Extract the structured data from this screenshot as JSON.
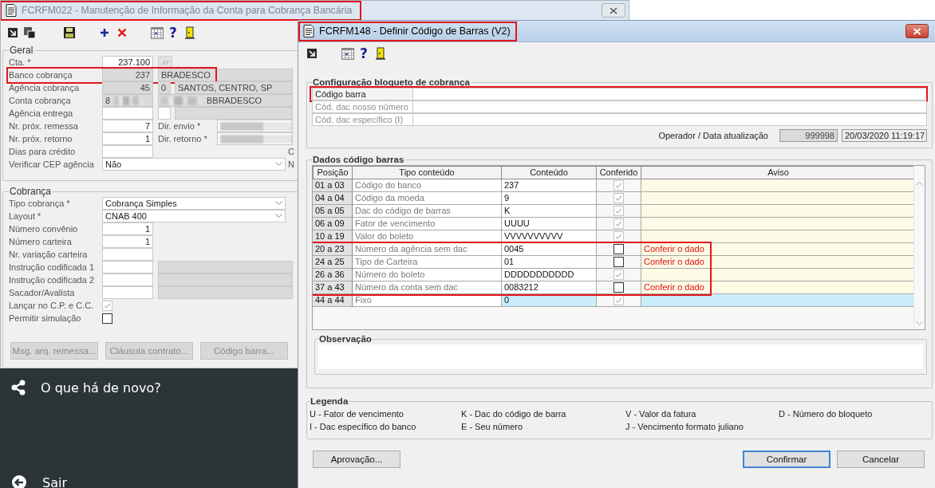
{
  "main_window": {
    "title": "FCRFM022 - Manutenção de Informação da Conta para Cobrança Bancária",
    "title_highlighted": true,
    "toolbar": [
      {
        "kind": "pointer"
      },
      {
        "kind": "windows"
      },
      {
        "kind": "save"
      },
      {
        "kind": "add"
      },
      {
        "kind": "delete"
      },
      {
        "kind": "calendar"
      },
      {
        "kind": "help",
        "glyph": "?"
      },
      {
        "kind": "exit"
      }
    ],
    "groups": [
      {
        "title": "Geral",
        "rows": [
          {
            "label": "Cta. *",
            "highlighted": false,
            "fields": [
              {
                "kind": "input",
                "value": "237.100",
                "readonly": false
              },
              {
                "kind": "lookup"
              }
            ]
          },
          {
            "label": "Banco cobrança",
            "highlighted": true,
            "fields": [
              {
                "kind": "input",
                "value": "237",
                "readonly": true
              },
              {
                "kind": "input",
                "value": "BRADESCO",
                "readonly": true
              }
            ]
          },
          {
            "label": "Agência cobrança",
            "highlighted": false,
            "fields": [
              {
                "kind": "input",
                "value": "45",
                "readonly": true
              },
              {
                "kind": "input",
                "value": "0",
                "readonly": true
              },
              {
                "kind": "input",
                "value": "SANTOS, CENTRO, SP",
                "readonly": true
              }
            ]
          },
          {
            "label": "Conta cobrança",
            "highlighted": false,
            "fields": [
              {
                "kind": "masked",
                "value": "8",
                "readonly": true
              },
              {
                "kind": "masked",
                "value": "BBRADESCO",
                "readonly": true
              }
            ]
          },
          {
            "label": "Agência entrega",
            "highlighted": false,
            "fields": [
              {
                "kind": "input",
                "readonly": false
              },
              {
                "kind": "input",
                "readonly": false
              },
              {
                "kind": "input",
                "readonly": true
              }
            ]
          },
          {
            "label": "Nr. próx. remessa",
            "highlighted": false,
            "fields": [
              {
                "kind": "input",
                "value": "7",
                "readonly": false
              },
              {
                "kind": "label",
                "value": "Dir. envio *"
              },
              {
                "kind": "masked",
                "readonly": false
              }
            ]
          },
          {
            "label": "Nr. próx. retorno",
            "highlighted": false,
            "fields": [
              {
                "kind": "input",
                "value": "1",
                "readonly": false
              },
              {
                "kind": "label",
                "value": "Dir. retorno *"
              },
              {
                "kind": "masked",
                "readonly": false
              }
            ]
          },
          {
            "label": "Dias para crédito",
            "highlighted": false,
            "fields": [
              {
                "kind": "input",
                "readonly": false
              }
            ],
            "far_label": "C"
          },
          {
            "label": "Verificar CEP agência",
            "highlighted": false,
            "fields": [
              {
                "kind": "select",
                "value": "Não"
              }
            ],
            "far_label": "N"
          }
        ]
      },
      {
        "title": "Cobrança",
        "rows": [
          {
            "label": "Tipo cobrança *",
            "highlighted": false,
            "fields": [
              {
                "kind": "select",
                "value": "Cobrança Simples"
              }
            ]
          },
          {
            "label": "Layout *",
            "highlighted": false,
            "fields": [
              {
                "kind": "select",
                "value": "CNAB 400"
              }
            ]
          },
          {
            "label": "Número convênio",
            "highlighted": false,
            "fields": [
              {
                "kind": "input",
                "value": "1",
                "readonly": false
              }
            ]
          },
          {
            "label": "Número carteira",
            "highlighted": false,
            "fields": [
              {
                "kind": "input",
                "value": "1",
                "readonly": false
              }
            ]
          },
          {
            "label": "Nr. variação carteira",
            "highlighted": false,
            "fields": [
              {
                "kind": "input",
                "readonly": false
              }
            ]
          },
          {
            "label": "Instrução codificada 1",
            "highlighted": false,
            "fields": [
              {
                "kind": "input",
                "readonly": false
              },
              {
                "kind": "input",
                "readonly": true
              }
            ]
          },
          {
            "label": "Instrução codificada 2",
            "highlighted": false,
            "fields": [
              {
                "kind": "input",
                "readonly": false
              },
              {
                "kind": "input",
                "readonly": true
              }
            ]
          },
          {
            "label": "Sacador/Avalista",
            "highlighted": false,
            "fields": [
              {
                "kind": "input",
                "readonly": false
              },
              {
                "kind": "input",
                "readonly": true
              }
            ]
          },
          {
            "label": "Lançar no C.P. e C.C.",
            "highlighted": false,
            "fields": [
              {
                "kind": "checkbox",
                "checked": true
              }
            ]
          },
          {
            "label": "Permitir simulação",
            "highlighted": false,
            "fields": [
              {
                "kind": "checkbox",
                "checked": false
              }
            ]
          }
        ]
      }
    ],
    "buttons": [
      {
        "label": "Msg. arq. remessa...",
        "disabled": true
      },
      {
        "label": "Cláusula contrato...",
        "disabled": true
      },
      {
        "label": "Código barra...",
        "disabled": true
      }
    ]
  },
  "side_panel": {
    "items": [
      {
        "kind": "share",
        "label": "O que há de novo?"
      },
      {
        "kind": "exit",
        "label": "Sair"
      }
    ]
  },
  "dialog": {
    "title": "FCRFM148 - Definir Código de Barras (V2)",
    "title_highlighted": true,
    "toolbar": [
      {
        "kind": "pointer"
      },
      {
        "kind": "calendar"
      },
      {
        "kind": "help",
        "glyph": "?"
      },
      {
        "kind": "exit"
      }
    ],
    "config": {
      "title": "Configuração bloqueto de cobrança",
      "rows": [
        {
          "label": "Código barra",
          "disabled": false,
          "highlighted": true
        },
        {
          "label": "Cód. dac nosso número",
          "disabled": true,
          "highlighted": false
        },
        {
          "label": "Cód. dac específico (I)",
          "disabled": true,
          "highlighted": false
        }
      ],
      "operator_label": "Operador / Data atualização",
      "operator": "999998",
      "updated_at": "20/03/2020 11:19:17"
    },
    "barcode": {
      "title": "Dados código barras",
      "columns": [
        "Posição",
        "Tipo conteúdo",
        "Conteúdo",
        "Conferido",
        "Aviso"
      ],
      "rows": [
        {
          "position": "01 a 03",
          "type": "Código do banco",
          "content": "237",
          "checked": true,
          "selected": false,
          "highlighted": false
        },
        {
          "position": "04 a 04",
          "type": "Código da moeda",
          "content": "9",
          "checked": true,
          "selected": false,
          "highlighted": false
        },
        {
          "position": "05 a 05",
          "type": "Dac do código de barras",
          "content": "K",
          "checked": true,
          "selected": false,
          "highlighted": false
        },
        {
          "position": "06 a 09",
          "type": "Fator de vencimento",
          "content": "UUUU",
          "checked": true,
          "selected": false,
          "highlighted": false
        },
        {
          "position": "10 a 19",
          "type": "Valor do boleto",
          "content": "VVVVVVVVVV",
          "checked": true,
          "selected": false,
          "highlighted": false
        },
        {
          "position": "20 a 23",
          "type": "Número da agência sem dac",
          "content": "0045",
          "checked": false,
          "warning": "Conferir o dado",
          "selected": false,
          "highlighted": true
        },
        {
          "position": "24 a 25",
          "type": "Tipo de Carteira",
          "content": "01",
          "checked": false,
          "warning": "Conferir o dado",
          "selected": false,
          "highlighted": true
        },
        {
          "position": "26 a 36",
          "type": "Número do boleto",
          "content": "DDDDDDDDDDD",
          "checked": true,
          "selected": false,
          "highlighted": true
        },
        {
          "position": "37 a 43",
          "type": "Número da conta sem dac",
          "content": "0083212",
          "checked": false,
          "warning": "Conferir o dado",
          "selected": false,
          "highlighted": true
        },
        {
          "position": "44 a 44",
          "type": "Fixo",
          "content": "0",
          "checked": true,
          "selected": true,
          "highlighted": false
        }
      ],
      "observation_title": "Observação"
    },
    "legend": {
      "title": "Legenda",
      "items": [
        "U - Fator de vencimento",
        "K - Dac do código de barra",
        "V - Valor da fatura",
        "D - Número do bloqueto",
        "I - Dac específico do banco",
        "E - Seu número",
        "J - Vencimento formato juliano"
      ]
    },
    "buttons": [
      {
        "label": "Aprovação...",
        "default": false
      },
      {
        "label": "Confirmar",
        "default": true
      },
      {
        "label": "Cancelar",
        "default": false
      }
    ]
  }
}
